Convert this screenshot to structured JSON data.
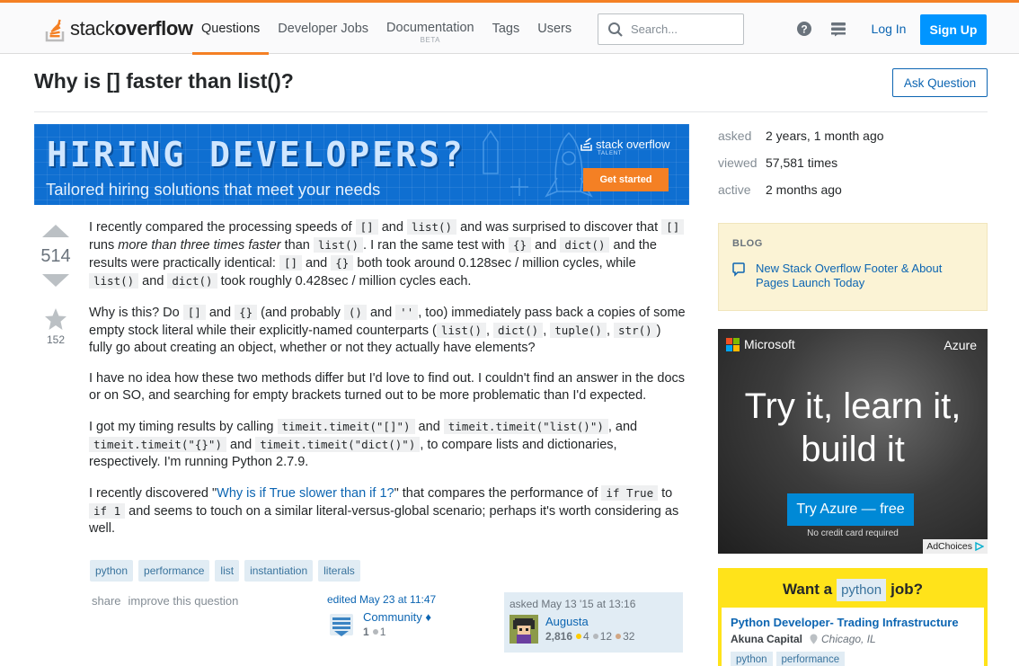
{
  "header": {
    "logo_text_light": "stack",
    "logo_text_bold": "overflow",
    "nav": [
      {
        "label": "Questions",
        "sub": ""
      },
      {
        "label": "Developer Jobs",
        "sub": ""
      },
      {
        "label": "Documentation",
        "sub": "BETA"
      },
      {
        "label": "Tags",
        "sub": ""
      },
      {
        "label": "Users",
        "sub": ""
      }
    ],
    "search_placeholder": "Search...",
    "login": "Log In",
    "signup": "Sign Up"
  },
  "question": {
    "title": "Why is [] faster than list()?",
    "ask_button": "Ask Question",
    "votes": "514",
    "favorites": "152",
    "p1": {
      "t1": "I recently compared the processing speeds of ",
      "c1": "[]",
      "t2": " and ",
      "c2": "list()",
      "t3": " and was surprised to discover that ",
      "c3": "[]",
      "t4": " runs ",
      "em": "more than three times faster",
      "t5": " than ",
      "c4": "list()",
      "t6": ". I ran the same test with ",
      "c5": "{}",
      "t7": " and ",
      "c6": "dict()",
      "t8": " and the results were practically identical: ",
      "c7": "[]",
      "t9": " and ",
      "c8": "{}",
      "t10": " both took around 0.128sec / million cycles, while ",
      "c9": "list()",
      "t11": " and ",
      "c10": "dict()",
      "t12": " took roughly 0.428sec / million cycles each."
    },
    "p2": {
      "t1": "Why is this? Do ",
      "c1": "[]",
      "t2": " and ",
      "c2": "{}",
      "t3": " (and probably ",
      "c3": "()",
      "t4": " and ",
      "c4": "''",
      "t5": ", too) immediately pass back a copies of some empty stock literal while their explicitly-named counterparts (",
      "c5": "list()",
      "t6": ", ",
      "c6": "dict()",
      "t7": ", ",
      "c7": "tuple()",
      "t8": ", ",
      "c8": "str()",
      "t9": ") fully go about creating an object, whether or not they actually have elements?"
    },
    "p3": "I have no idea how these two methods differ but I'd love to find out. I couldn't find an answer in the docs or on SO, and searching for empty brackets turned out to be more problematic than I'd expected.",
    "p4": {
      "t1": "I got my timing results by calling ",
      "c1": "timeit.timeit(\"[]\")",
      "t2": " and ",
      "c2": "timeit.timeit(\"list()\")",
      "t3": ", and ",
      "c3": "timeit.timeit(\"{}\")",
      "t4": " and ",
      "c4": "timeit.timeit(\"dict()\")",
      "t5": ", to compare lists and dictionaries, respectively. I'm running Python 2.7.9."
    },
    "p5": {
      "t1": "I recently discovered \"",
      "link": "Why is if True slower than if 1?",
      "t2": "\" that compares the performance of ",
      "c1": "if True",
      "t3": " to ",
      "c2": "if 1",
      "t4": " and seems to touch on a similar literal-versus-global scenario; perhaps it's worth considering as well."
    },
    "tags": [
      "python",
      "performance",
      "list",
      "instantiation",
      "literals"
    ],
    "menu": {
      "share": "share",
      "improve": "improve this question"
    },
    "edited": {
      "action": "edited May 23 at 11:47",
      "name": "Community",
      "diamond": "♦",
      "rep": "1",
      "badges": "1"
    },
    "asked": {
      "action": "asked May 13 '15 at 13:16",
      "name": "Augusta",
      "rep": "2,816",
      "gold": "4",
      "silver": "12",
      "bronze": "32"
    }
  },
  "banner": {
    "headline": "HIRING DEVELOPERS?",
    "subline": "Tailored hiring solutions that meet your needs",
    "brand": "stack overflow",
    "brand_sub": "TALENT",
    "cta": "Get started"
  },
  "stats": [
    {
      "label": "asked",
      "value": "2 years, 1 month ago"
    },
    {
      "label": "viewed",
      "value": "57,581 times"
    },
    {
      "label": "active",
      "value": "2 months ago"
    }
  ],
  "blog": {
    "heading": "BLOG",
    "item": "New Stack Overflow Footer & About Pages Launch Today"
  },
  "ad": {
    "brand": "Microsoft",
    "product": "Azure",
    "line1": "Try it, learn it,",
    "line2": "build it",
    "button": "Try Azure — free",
    "fine": "No credit card required",
    "adchoices": "AdChoices"
  },
  "jobs": {
    "pre": "Want a",
    "tag": "python",
    "post": "job?",
    "title": "Python Developer- Trading Infrastructure",
    "company": "Akuna Capital",
    "location": "Chicago, IL",
    "tags": [
      "python",
      "performance"
    ]
  },
  "colors": {
    "accent": "#f48024",
    "link": "#0c65b2",
    "signup": "#0095ff",
    "tag_bg": "#e1ecf4",
    "tag_text": "#39739d"
  }
}
